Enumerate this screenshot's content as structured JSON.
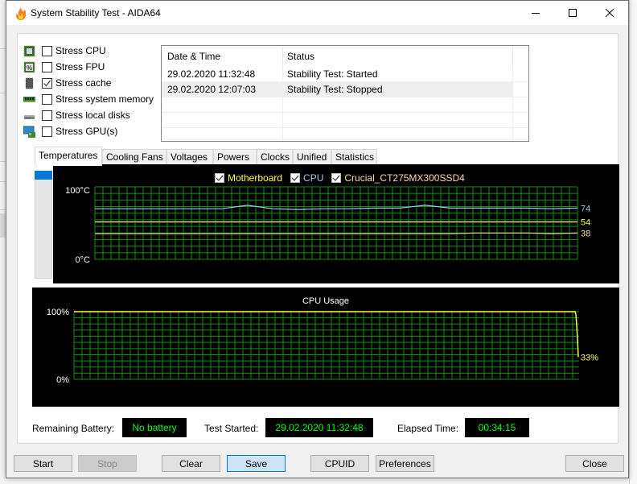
{
  "window": {
    "title": "System Stability Test - AIDA64",
    "controls": {
      "minimize": "minimize",
      "maximize": "maximize",
      "close": "close"
    }
  },
  "stress_options": [
    {
      "label": "Stress CPU",
      "checked": false,
      "icon": "cpu-chip-icon"
    },
    {
      "label": "Stress FPU",
      "checked": false,
      "icon": "fpu-chip-icon"
    },
    {
      "label": "Stress cache",
      "checked": true,
      "icon": "cache-chip-icon"
    },
    {
      "label": "Stress system memory",
      "checked": false,
      "icon": "memory-module-icon"
    },
    {
      "label": "Stress local disks",
      "checked": false,
      "icon": "hard-disk-icon"
    },
    {
      "label": "Stress GPU(s)",
      "checked": false,
      "icon": "gpu-monitor-icon"
    }
  ],
  "log": {
    "columns": [
      "Date & Time",
      "Status"
    ],
    "rows": [
      {
        "datetime": "29.02.2020 11:32:48",
        "status": "Stability Test: Started",
        "selected": false
      },
      {
        "datetime": "29.02.2020 12:07:03",
        "status": "Stability Test: Stopped",
        "selected": true
      }
    ]
  },
  "tabs": [
    {
      "label": "Temperatures",
      "active": true
    },
    {
      "label": "Cooling Fans",
      "active": false
    },
    {
      "label": "Voltages",
      "active": false
    },
    {
      "label": "Powers",
      "active": false
    },
    {
      "label": "Clocks",
      "active": false
    },
    {
      "label": "Unified",
      "active": false
    },
    {
      "label": "Statistics",
      "active": false
    }
  ],
  "colors": {
    "grid": "#109010",
    "motherboard": "#ffff40",
    "cpu": "#a8c8e8",
    "ssd": "#ffd8a0",
    "cpu_usage": "#ffff40",
    "status_value": "#00ff00",
    "accent": "#0078d7"
  },
  "chart_data": [
    {
      "type": "line",
      "title": "Temperatures",
      "ylabel_top": "100°C",
      "ylabel_bottom": "0°C",
      "ylim": [
        0,
        100
      ],
      "grid": true,
      "legend_position": "top-center",
      "series": [
        {
          "name": "Motherboard",
          "checked": true,
          "color": "#ffff40",
          "current": 54,
          "values": [
            54,
            54,
            54,
            54,
            54,
            54,
            54,
            54,
            54,
            54,
            54,
            54,
            54,
            54,
            54,
            54,
            54,
            54,
            54,
            54
          ]
        },
        {
          "name": "CPU",
          "checked": true,
          "color": "#a8c8e8",
          "current": 74,
          "values": [
            73,
            73,
            73,
            73,
            73,
            73,
            78,
            73,
            72,
            73,
            73,
            74,
            74,
            78,
            74,
            74,
            74,
            74,
            73,
            74
          ]
        },
        {
          "name": "Crucial_CT275MX300SSD4",
          "checked": true,
          "color": "#ffd8a0",
          "current": 38,
          "values": [
            37,
            37,
            37,
            37,
            37,
            37,
            37,
            37,
            37,
            37,
            37,
            37,
            37,
            37,
            37,
            38,
            38,
            38,
            37,
            38
          ]
        }
      ]
    },
    {
      "type": "line",
      "title": "CPU Usage",
      "ylabel_top": "100%",
      "ylabel_bottom": "0%",
      "ylim": [
        0,
        100
      ],
      "grid": true,
      "series": [
        {
          "name": "CPU Usage",
          "color": "#ffff40",
          "current_label": "33%",
          "values": [
            100,
            100,
            100,
            100,
            100,
            100,
            100,
            100,
            100,
            100,
            100,
            100,
            100,
            100,
            100,
            100,
            100,
            100,
            100,
            100,
            100,
            100,
            96,
            80,
            60,
            33
          ]
        }
      ]
    }
  ],
  "status": {
    "battery_label": "Remaining Battery:",
    "battery_value": "No battery",
    "started_label": "Test Started:",
    "started_value": "29.02.2020 11:32:48",
    "elapsed_label": "Elapsed Time:",
    "elapsed_value": "00:34:15"
  },
  "buttons": {
    "start": "Start",
    "stop": "Stop",
    "clear": "Clear",
    "save": "Save",
    "cpuid": "CPUID",
    "preferences": "Preferences",
    "close": "Close"
  }
}
